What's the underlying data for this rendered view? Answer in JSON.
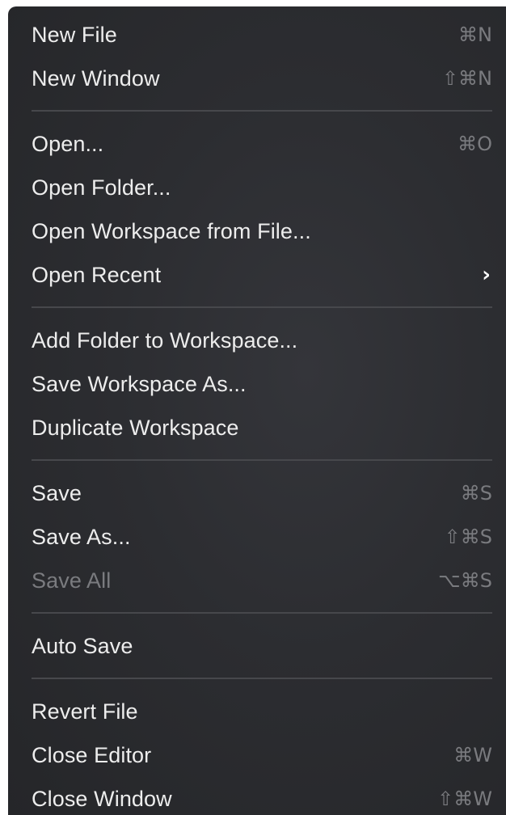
{
  "menu": {
    "items": [
      {
        "label": "New File",
        "shortcut": "⌘N"
      },
      {
        "label": "New Window",
        "shortcut": "⇧⌘N"
      },
      {
        "label": "Open...",
        "shortcut": "⌘O"
      },
      {
        "label": "Open Folder..."
      },
      {
        "label": "Open Workspace from File..."
      },
      {
        "label": "Open Recent",
        "submenu_icon": "chevron-right-icon",
        "submenu_glyph": "›"
      },
      {
        "label": "Add Folder to Workspace..."
      },
      {
        "label": "Save Workspace As..."
      },
      {
        "label": "Duplicate Workspace"
      },
      {
        "label": "Save",
        "shortcut": "⌘S"
      },
      {
        "label": "Save As...",
        "shortcut": "⇧⌘S"
      },
      {
        "label": "Save All",
        "shortcut": "⌥⌘S",
        "state": "disabled"
      },
      {
        "label": "Auto Save"
      },
      {
        "label": "Revert File"
      },
      {
        "label": "Close Editor",
        "shortcut": "⌘W"
      },
      {
        "label": "Close Window",
        "shortcut": "⇧⌘W"
      }
    ]
  }
}
